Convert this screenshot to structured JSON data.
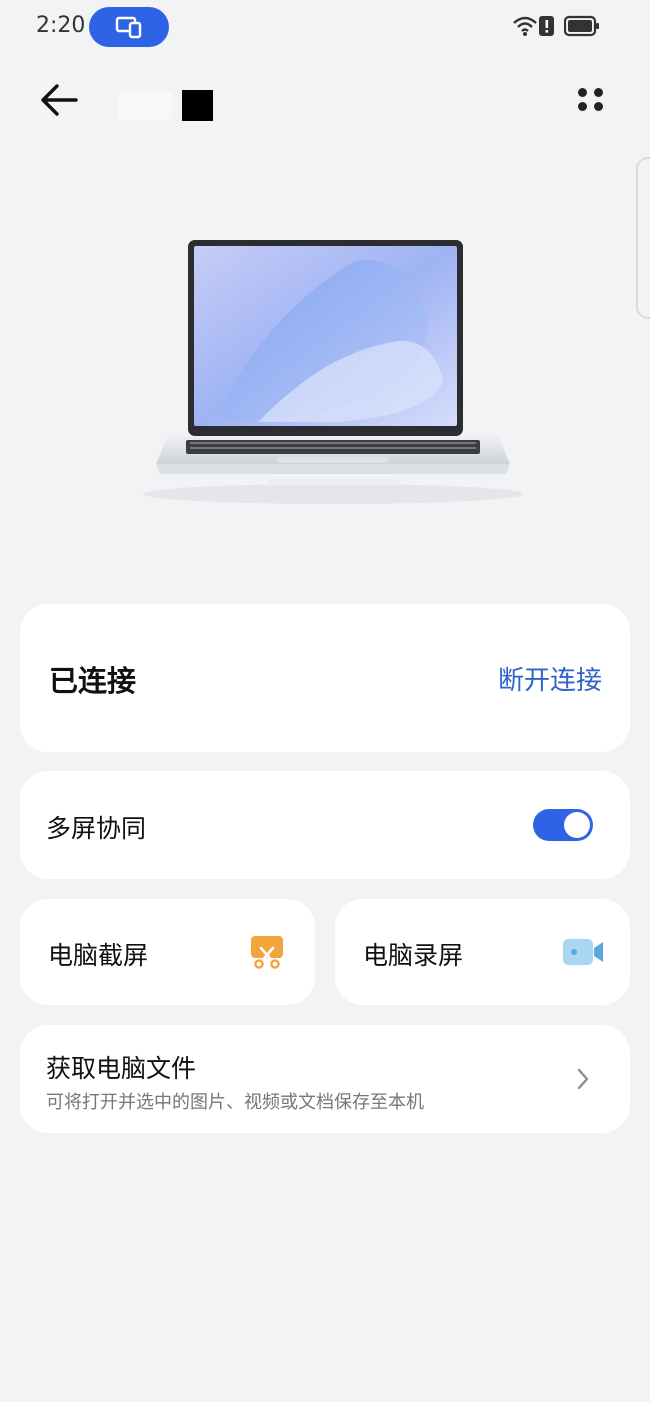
{
  "status_bar": {
    "time": "2:20",
    "icons": [
      "screen-share-icon",
      "wifi-icon",
      "alert-icon",
      "battery-icon"
    ],
    "accent": "#2f63e6"
  },
  "header": {
    "back_icon": "arrow-left-icon",
    "more_icon": "more-dots-icon"
  },
  "device": {
    "image": "laptop-image"
  },
  "connection": {
    "status_label": "已连接",
    "disconnect_label": "断开连接",
    "link_color": "#2f63c9"
  },
  "multiscreen": {
    "label": "多屏协同",
    "enabled": true
  },
  "tiles": {
    "screenshot": {
      "label": "电脑截屏",
      "icon": "scissors-screenshot-icon",
      "color": "#f2a53a"
    },
    "record": {
      "label": "电脑录屏",
      "icon": "video-camera-icon",
      "color": "#6fb8e6"
    }
  },
  "files": {
    "title": "获取电脑文件",
    "subtitle": "可将打开并选中的图片、视频或文档保存至本机",
    "chevron_icon": "chevron-right-icon"
  }
}
